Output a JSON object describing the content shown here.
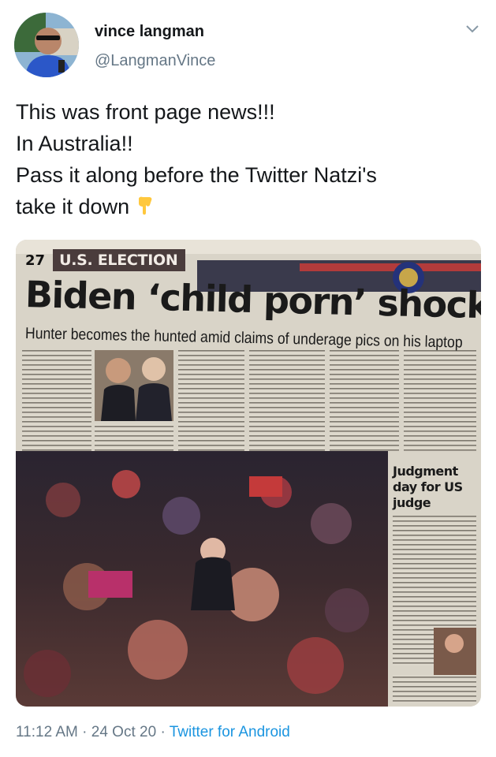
{
  "author": {
    "display_name": "vince langman",
    "handle": "@LangmanVince",
    "avatar_icon": "profile-photo-avatar"
  },
  "tweet": {
    "lines": [
      "This was front page news!!!",
      "In Australia!!",
      "Pass it along before the Twitter Natzi's",
      "take it down"
    ],
    "emoji": "backhand-index-pointing-down"
  },
  "media": {
    "page_number": "27",
    "section": "U.S. ELECTION",
    "headline": "Biden ‘child porn’ shock",
    "subheadline": "Hunter becomes the hunted amid claims of underage pics on his laptop",
    "sidebar_headline": "Judgment day for US judge"
  },
  "footer": {
    "time": "11:12 AM",
    "date": "24 Oct 20",
    "source": "Twitter for Android",
    "separator": "·"
  },
  "colors": {
    "text": "#14171a",
    "secondary": "#657786",
    "link": "#1b95e0"
  }
}
